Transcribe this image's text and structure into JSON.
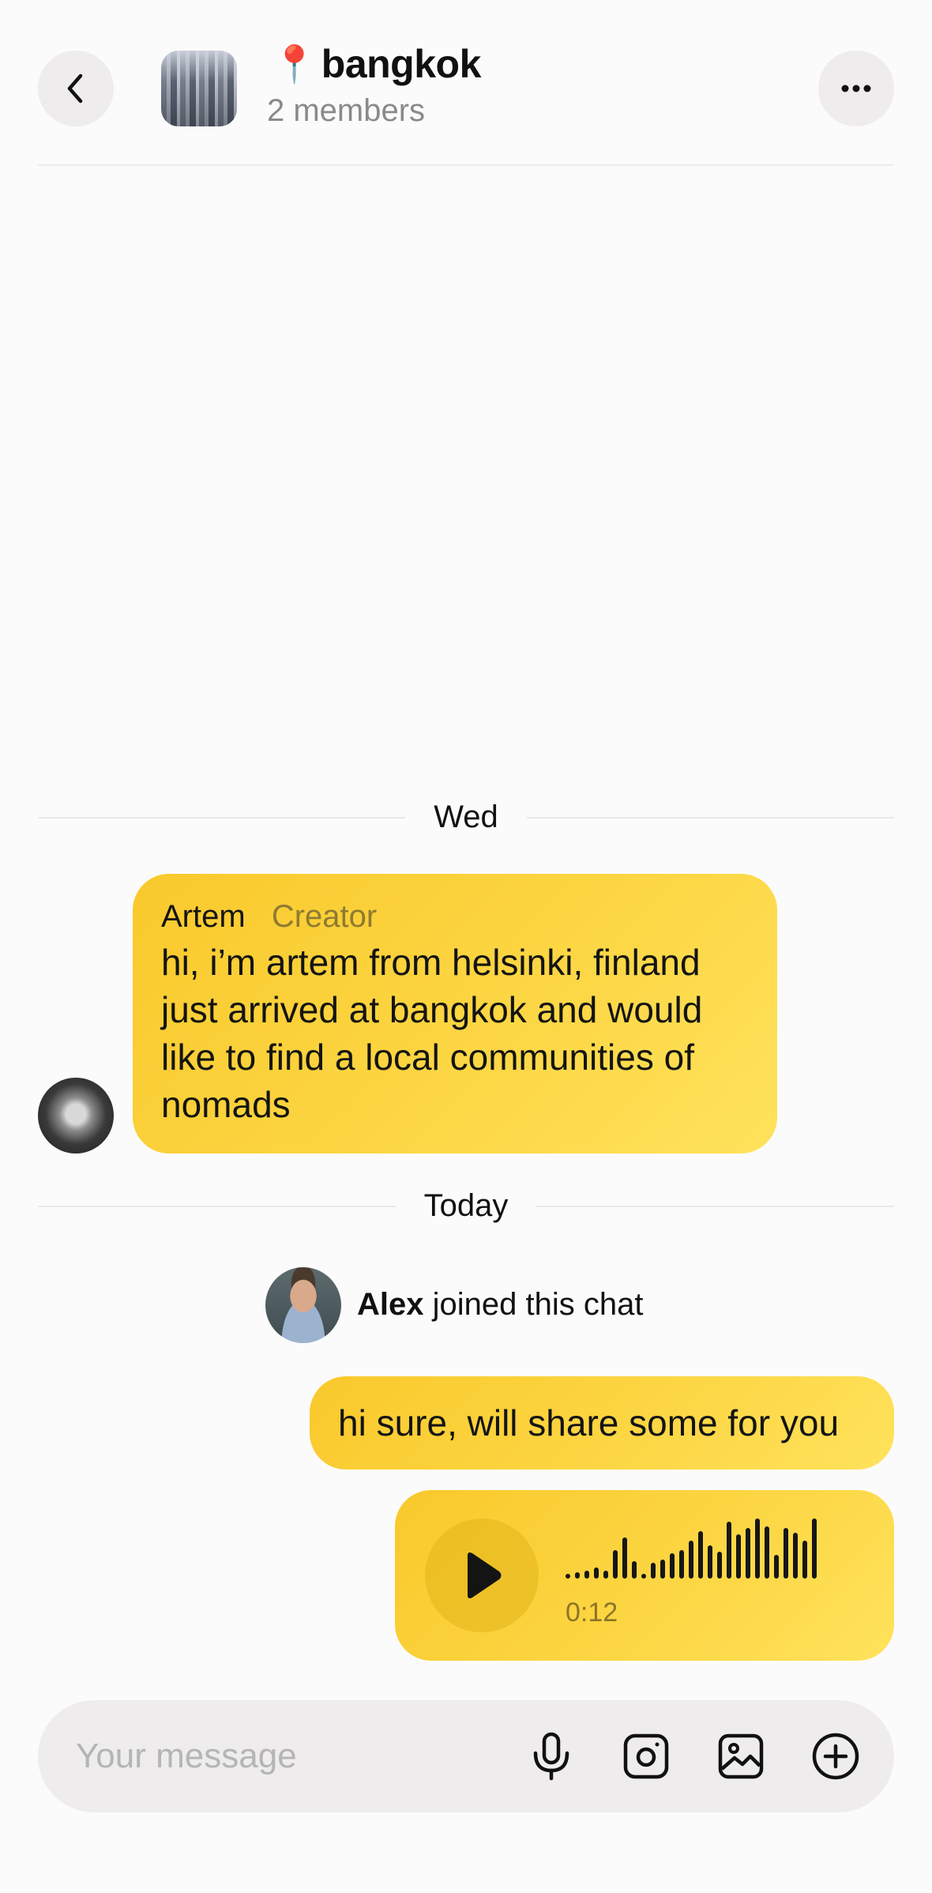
{
  "header": {
    "title_emoji": "📍",
    "title": "bangkok",
    "subtitle": "2 members",
    "back_icon": "chevron-left-icon",
    "more_icon": "ellipsis-icon"
  },
  "days": {
    "first": "Wed",
    "second": "Today"
  },
  "messages": [
    {
      "author": "Artem",
      "role": "Creator",
      "text": "hi, i’m artem from helsinki, finland just arrived at bangkok and would like to find a local communities of nomads"
    }
  ],
  "system": {
    "name": "Alex",
    "action": "joined this chat"
  },
  "outgoing": {
    "text": "hi sure, will share some for you"
  },
  "voice": {
    "duration": "0:12",
    "play_icon": "play-icon"
  },
  "composer": {
    "placeholder": "Your message",
    "icons": [
      "microphone-icon",
      "camera-icon",
      "image-icon",
      "plus-circle-icon"
    ]
  },
  "colors": {
    "bubble": "#fcd643",
    "background": "#fcfbfb",
    "muted": "#8a8a8a"
  }
}
